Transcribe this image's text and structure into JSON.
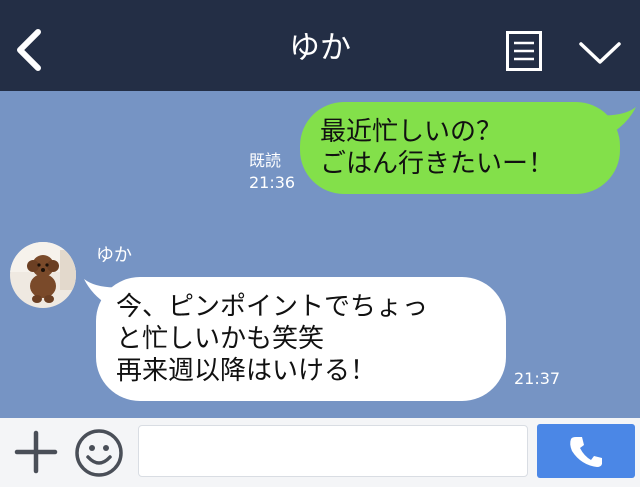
{
  "header": {
    "title": "ゆか",
    "icons": {
      "back": "back-arrow-icon",
      "menu": "menu-icon",
      "collapse": "chevron-down-icon"
    },
    "background": "#232e45"
  },
  "chat": {
    "background": "#7694c4",
    "outgoing": {
      "text": "最近忙しいの？\nごはん行きたいー！",
      "read_label": "既読",
      "time": "21:36",
      "bubble_color": "#83e04a"
    },
    "incoming": {
      "sender": "ゆか",
      "text": "今、ピンポイントでちょっ\nと忙しいかも笑笑\n再来週以降はいける！",
      "time": "21:37",
      "bubble_color": "#ffffff",
      "avatar": "dog-avatar"
    }
  },
  "input_bar": {
    "message_value": "",
    "icons": {
      "add": "plus-icon",
      "emoji": "smiley-icon",
      "call": "phone-icon"
    },
    "call_color": "#4b87e6"
  }
}
